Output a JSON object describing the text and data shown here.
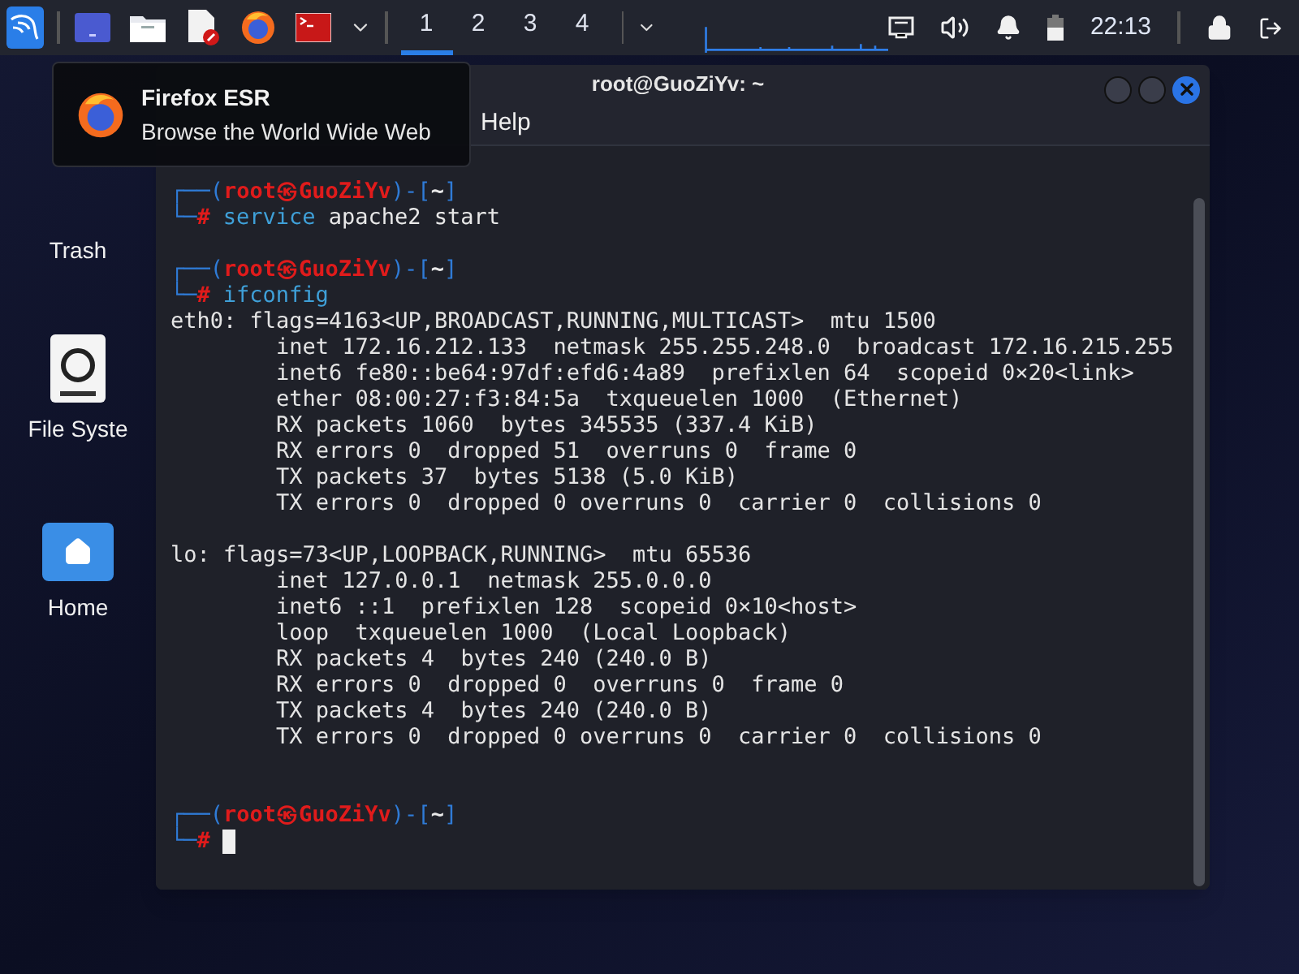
{
  "taskbar": {
    "apps": [
      {
        "kind": "window"
      },
      {
        "kind": "folder"
      },
      {
        "kind": "editor"
      },
      {
        "kind": "firefox"
      },
      {
        "kind": "terminal"
      }
    ],
    "workspaces": [
      {
        "label": "1",
        "selected": true
      },
      {
        "label": "2",
        "selected": false
      },
      {
        "label": "3",
        "selected": false
      },
      {
        "label": "4",
        "selected": false
      }
    ],
    "clock": "22:13"
  },
  "desktop_icons": [
    {
      "kind": "trash",
      "label": "Trash"
    },
    {
      "kind": "drive",
      "label": "File Syste"
    },
    {
      "kind": "home",
      "label": "Home"
    }
  ],
  "tooltip": {
    "title": "Firefox ESR",
    "subtitle": "Browse the World Wide Web"
  },
  "terminal": {
    "title": "root@GuoZiYv: ~",
    "menu": [
      "Help"
    ],
    "lines": [
      {
        "kind": "prompt",
        "corner": "┌──(",
        "user": "root㉿GuoZiYv",
        "sep": ")-[",
        "dir": "~",
        "end": "]"
      },
      {
        "kind": "command",
        "corner": "└─",
        "mark": "#",
        "name": "service",
        "args": "apache2 start",
        "cursor": false
      },
      {
        "kind": "blank"
      },
      {
        "kind": "prompt",
        "corner": "┌──(",
        "user": "root㉿GuoZiYv",
        "sep": ")-[",
        "dir": "~",
        "end": "]"
      },
      {
        "kind": "command",
        "corner": "└─",
        "mark": "#",
        "name": "ifconfig",
        "cursor": false
      },
      {
        "kind": "output",
        "text": "eth0: flags=4163<UP,BROADCAST,RUNNING,MULTICAST>  mtu 1500"
      },
      {
        "kind": "output",
        "text": "        inet 172.16.212.133  netmask 255.255.248.0  broadcast 172.16.215.255"
      },
      {
        "kind": "output",
        "text": "        inet6 fe80::be64:97df:efd6:4a89  prefixlen 64  scopeid 0×20<link>"
      },
      {
        "kind": "output",
        "text": "        ether 08:00:27:f3:84:5a  txqueuelen 1000  (Ethernet)"
      },
      {
        "kind": "output",
        "text": "        RX packets 1060  bytes 345535 (337.4 KiB)"
      },
      {
        "kind": "output",
        "text": "        RX errors 0  dropped 51  overruns 0  frame 0"
      },
      {
        "kind": "output",
        "text": "        TX packets 37  bytes 5138 (5.0 KiB)"
      },
      {
        "kind": "output",
        "text": "        TX errors 0  dropped 0 overruns 0  carrier 0  collisions 0"
      },
      {
        "kind": "blank"
      },
      {
        "kind": "output",
        "text": "lo: flags=73<UP,LOOPBACK,RUNNING>  mtu 65536"
      },
      {
        "kind": "output",
        "text": "        inet 127.0.0.1  netmask 255.0.0.0"
      },
      {
        "kind": "output",
        "text": "        inet6 ::1  prefixlen 128  scopeid 0×10<host>"
      },
      {
        "kind": "output",
        "text": "        loop  txqueuelen 1000  (Local Loopback)"
      },
      {
        "kind": "output",
        "text": "        RX packets 4  bytes 240 (240.0 B)"
      },
      {
        "kind": "output",
        "text": "        RX errors 0  dropped 0  overruns 0  frame 0"
      },
      {
        "kind": "output",
        "text": "        TX packets 4  bytes 240 (240.0 B)"
      },
      {
        "kind": "output",
        "text": "        TX errors 0  dropped 0 overruns 0  carrier 0  collisions 0"
      },
      {
        "kind": "blank"
      },
      {
        "kind": "blank"
      },
      {
        "kind": "prompt",
        "corner": "┌──(",
        "user": "root㉿GuoZiYv",
        "sep": ")-[",
        "dir": "~",
        "end": "]"
      },
      {
        "kind": "command",
        "corner": "└─",
        "mark": "#",
        "cursor": true
      }
    ]
  }
}
